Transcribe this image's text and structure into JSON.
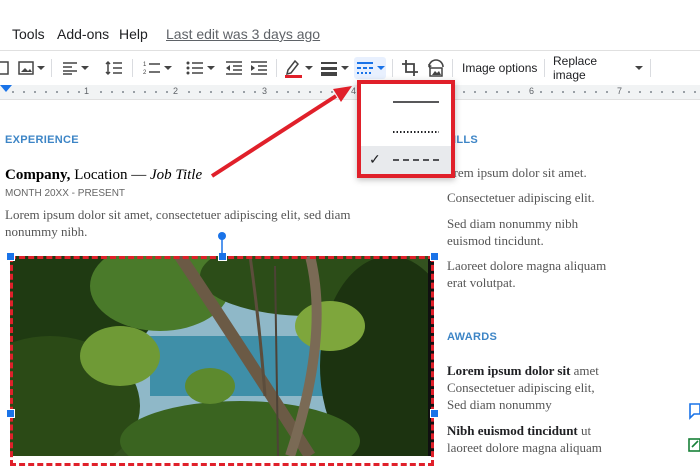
{
  "menubar": {
    "items": [
      "Tools",
      "Add-ons",
      "Help"
    ],
    "last_edit": "Last edit was 3 days ago"
  },
  "toolbar": {
    "image_options": "Image options",
    "replace_image": "Replace image",
    "colors": {
      "pen_underline": "#e0202a",
      "active": "#1a73e8"
    }
  },
  "ruler": {
    "numbers": [
      "1",
      "2",
      "3",
      "4",
      "5",
      "6",
      "7"
    ]
  },
  "border_dash_menu": {
    "options": [
      "solid",
      "dotted",
      "dashed"
    ],
    "selected": "dashed"
  },
  "document": {
    "experience_title": "EXPERIENCE",
    "company": "Company,",
    "location": " Location — ",
    "job_title": "Job Title",
    "dates": "MONTH 20XX - PRESENT",
    "experience_text": "Lorem ipsum dolor sit amet, consectetuer adipiscing elit, sed diam nonummy nibh.",
    "skills_title": "ILLS",
    "skills": [
      "orem ipsum dolor sit amet.",
      "Consectetuer adipiscing elit.",
      "Sed diam nonummy nibh euismod tincidunt.",
      "Laoreet dolore magna aliquam erat volutpat."
    ],
    "awards_title": "AWARDS",
    "award1_bold": "Lorem ipsum dolor sit",
    "award1_rest": " amet Consectetuer adipiscing elit, Sed diam nonummy",
    "award2_bold": "Nibh euismod tincidunt",
    "award2_rest": " ut laoreet dolore magna aliquam"
  },
  "annotation": {
    "color": "#e0202a"
  }
}
